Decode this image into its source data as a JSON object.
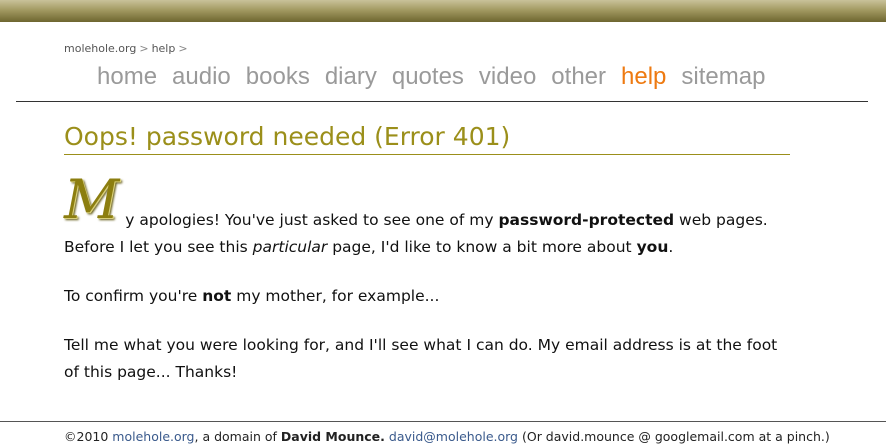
{
  "breadcrumb": {
    "items": [
      "molehole.org",
      "help"
    ],
    "separator": ">"
  },
  "nav": {
    "items": [
      "home",
      "audio",
      "books",
      "diary",
      "quotes",
      "video",
      "other",
      "help",
      "sitemap"
    ],
    "active": "help",
    "active_color": "#ee7a11",
    "inactive_color": "#9a9a9a"
  },
  "page": {
    "title": "Oops! password needed (Error 401)",
    "title_color": "#9b8f1a",
    "dropcap": "M",
    "para1": {
      "a": "y apologies! You've just asked to see one of my ",
      "b": "password-protected",
      "c": " web pages. Before I let you see this ",
      "d": "particular",
      "e": " page, I'd like to know a bit more about ",
      "f": "you",
      "g": "."
    },
    "para2": {
      "a": "To confirm you're ",
      "b": "not",
      "c": " my mother, for example..."
    },
    "para3": "Tell me what you were looking for, and I'll see what I can do. My email address is at the foot of this page... Thanks!"
  },
  "footer": {
    "copyright": "©2010 ",
    "site_link": "molehole.org",
    "domain_of": ", a domain of ",
    "author": "David Mounce.",
    "email_link": "david@molehole.org",
    "alt_email": " (Or david.mounce @ googlemail.com at a pinch.)"
  }
}
